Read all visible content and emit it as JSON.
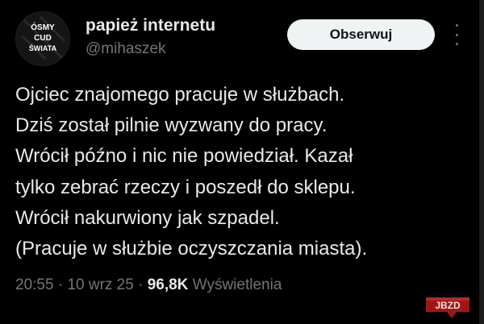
{
  "author": {
    "avatar_text": [
      "ÓSMY",
      "CUD",
      "ŚWIATA"
    ],
    "name": "papież internetu",
    "handle": "@mihaszek"
  },
  "follow_button": {
    "label": "Obserwuj"
  },
  "more_icon": "more-vertical-icon",
  "tweet": {
    "lines": [
      "Ojciec znajomego pracuje w służbach.",
      "Dziś został pilnie wyzwany do pracy.",
      "Wrócił późno i nic nie powiedział. Kazał",
      "tylko zebrać rzeczy i poszedł do sklepu.",
      "Wrócił nakurwiony jak szpadel.",
      "(Pracuje w służbie oczyszczania miasta)."
    ]
  },
  "meta": {
    "time": "20:55",
    "sep1": " · ",
    "date": "10 wrz 25",
    "sep2": " · ",
    "views_count": "96,8K",
    "views_label": " Wyświetlenia"
  },
  "watermark": {
    "text": "JBZD"
  },
  "colors": {
    "background": "#000000",
    "text": "#e7e9ea",
    "secondary": "#71767b",
    "button_bg": "#eff3f4",
    "watermark": "#c62828"
  }
}
